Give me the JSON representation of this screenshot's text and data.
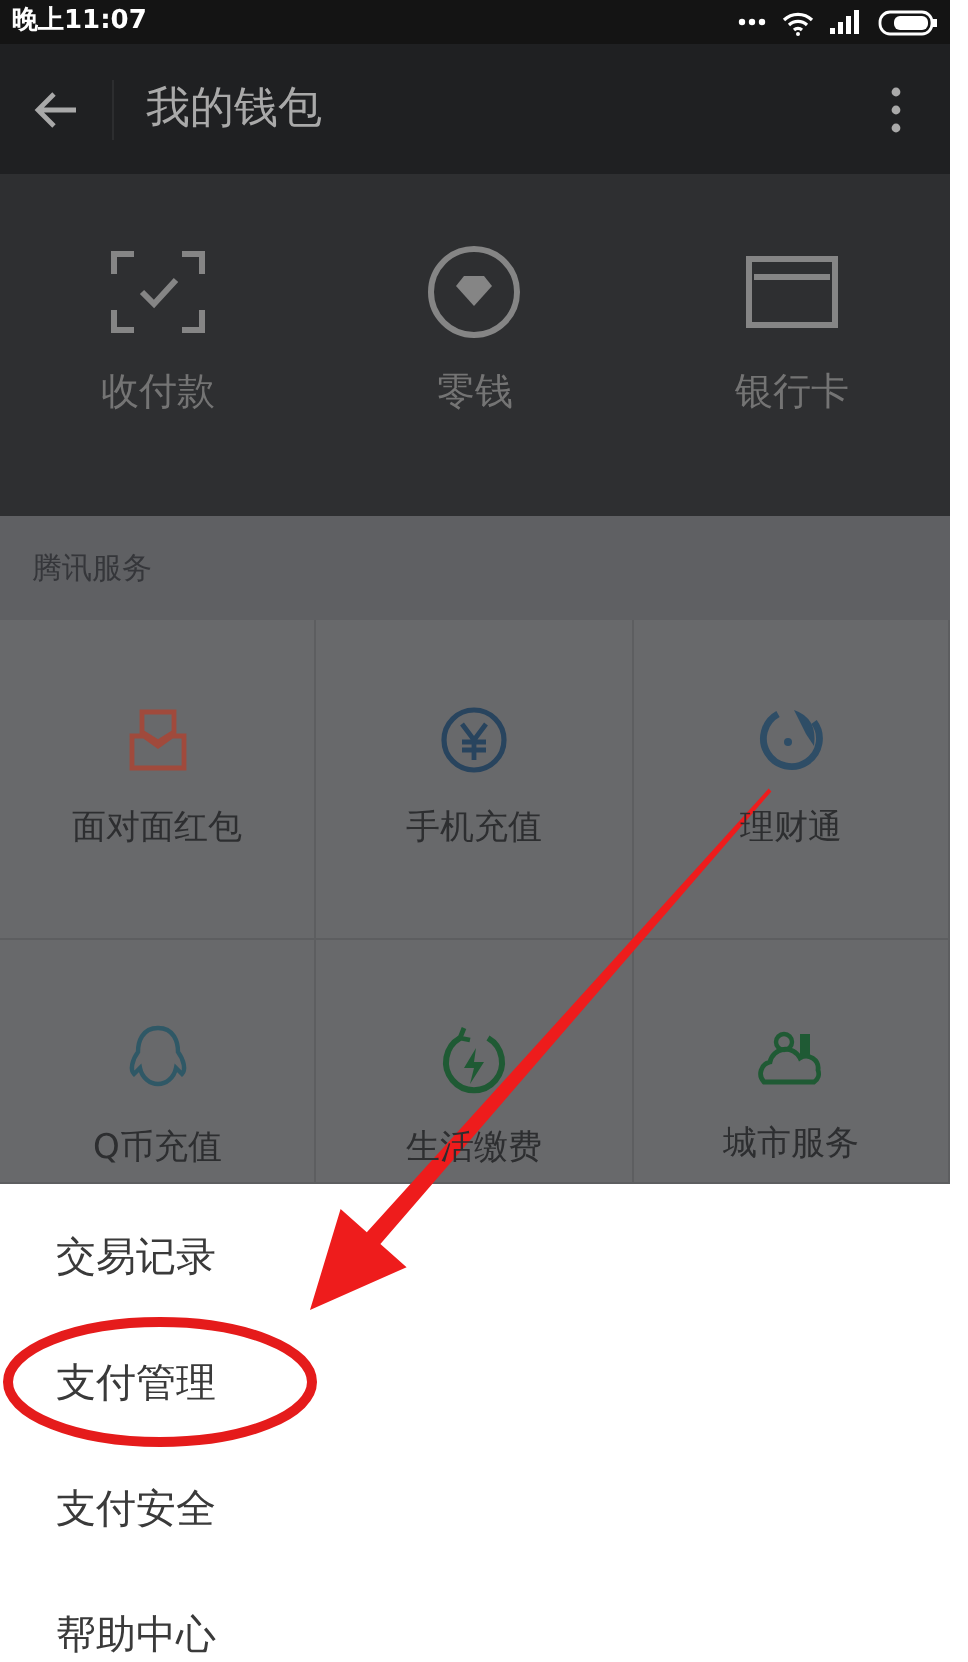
{
  "status_bar": {
    "time": "晚上11:07"
  },
  "header": {
    "title": "我的钱包"
  },
  "wallet_actions": [
    {
      "label": "收付款",
      "kind": "scan"
    },
    {
      "label": "零钱",
      "kind": "coin"
    },
    {
      "label": "银行卡",
      "kind": "card"
    }
  ],
  "services": {
    "title": "腾讯服务",
    "items": [
      {
        "label": "面对面红包",
        "kind": "packet"
      },
      {
        "label": "手机充值",
        "kind": "yen"
      },
      {
        "label": "理财通",
        "kind": "swirl"
      },
      {
        "label": "Q币充值",
        "kind": "penguin"
      },
      {
        "label": "生活缴费",
        "kind": "bolt"
      },
      {
        "label": "城市服务",
        "kind": "city"
      }
    ]
  },
  "menu": {
    "items": [
      {
        "label": "交易记录",
        "circled": false
      },
      {
        "label": "支付管理",
        "circled": true
      },
      {
        "label": "支付安全",
        "circled": false
      },
      {
        "label": "帮助中心",
        "circled": false
      }
    ]
  }
}
